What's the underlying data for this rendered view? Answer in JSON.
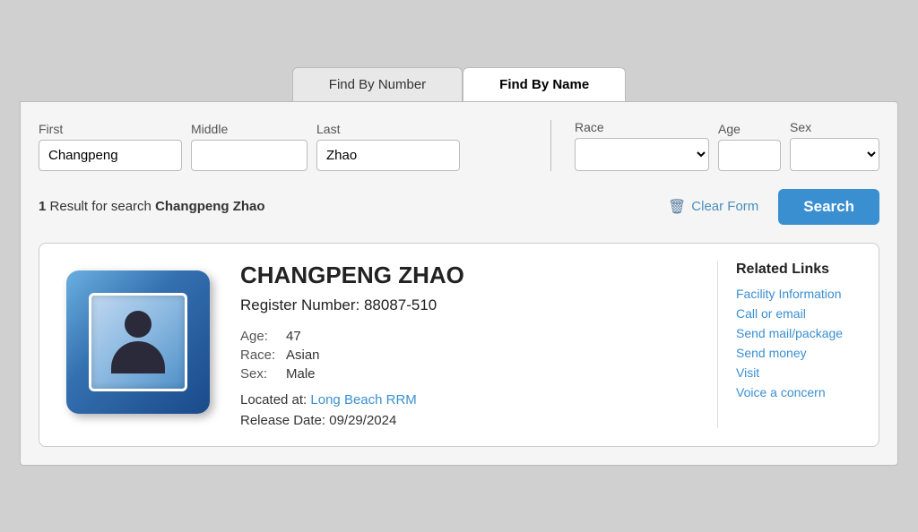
{
  "tabs": [
    {
      "id": "find-by-number",
      "label": "Find By Number",
      "active": false
    },
    {
      "id": "find-by-name",
      "label": "Find By Name",
      "active": true
    }
  ],
  "form": {
    "first_label": "First",
    "middle_label": "Middle",
    "last_label": "Last",
    "race_label": "Race",
    "age_label": "Age",
    "sex_label": "Sex",
    "first_value": "Changpeng",
    "middle_value": "",
    "last_value": "Zhao",
    "race_value": "",
    "age_value": "",
    "sex_value": ""
  },
  "results_bar": {
    "count": "1",
    "result_text": "Result for search",
    "search_name": "Changpeng Zhao",
    "clear_form_label": "Clear Form",
    "search_label": "Search"
  },
  "result_card": {
    "name": "CHANGPENG ZHAO",
    "register_number_label": "Register Number:",
    "register_number": "88087-510",
    "age_label": "Age:",
    "age_value": "47",
    "race_label": "Race:",
    "race_value": "Asian",
    "sex_label": "Sex:",
    "sex_value": "Male",
    "location_label": "Located at:",
    "location_link": "Long Beach RRM",
    "release_label": "Release Date:",
    "release_date": "09/29/2024"
  },
  "related_links": {
    "title": "Related Links",
    "links": [
      "Facility Information",
      "Call or email",
      "Send mail/package",
      "Send money",
      "Visit",
      "Voice a concern"
    ]
  }
}
